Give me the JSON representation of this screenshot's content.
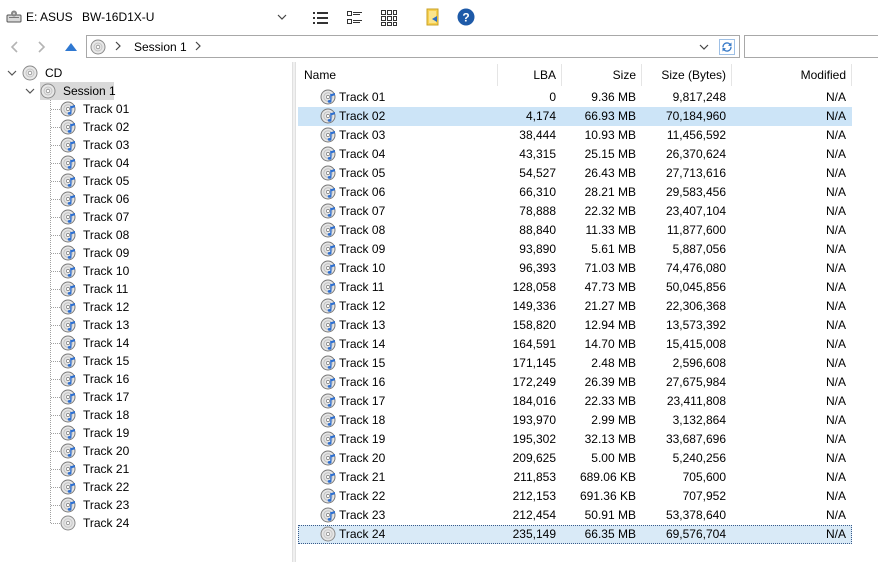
{
  "toolbar": {
    "drive_label": "E: ASUS",
    "device_label": "BW-16D1X-U",
    "icons": {
      "drive": "optical-drive-icon",
      "details": "details-view-icon",
      "tiles": "tiles-view-icon",
      "large": "large-icons-view-icon",
      "folder": "folder-arrow-icon",
      "help": "help-icon"
    },
    "help_color": "#1e5aa8",
    "folder_color": "#f7d04f"
  },
  "address": {
    "crumbs": [
      "Session 1"
    ],
    "icons": {
      "back": "back-arrow-icon",
      "forward": "forward-arrow-icon",
      "up": "up-arrow-icon",
      "refresh": "refresh-icon"
    }
  },
  "tree": {
    "root": "CD",
    "session": "Session 1",
    "tracks": [
      "Track 01",
      "Track 02",
      "Track 03",
      "Track 04",
      "Track 05",
      "Track 06",
      "Track 07",
      "Track 08",
      "Track 09",
      "Track 10",
      "Track 11",
      "Track 12",
      "Track 13",
      "Track 14",
      "Track 15",
      "Track 16",
      "Track 17",
      "Track 18",
      "Track 19",
      "Track 20",
      "Track 21",
      "Track 22",
      "Track 23",
      "Track 24"
    ],
    "audio_track_count": 23
  },
  "list": {
    "columns": [
      "Name",
      "LBA",
      "Size",
      "Size (Bytes)",
      "Modified"
    ],
    "rows": [
      {
        "name": "Track 01",
        "lba": "0",
        "size": "9.36 MB",
        "bytes": "9,817,248",
        "modified": "N/A"
      },
      {
        "name": "Track 02",
        "lba": "4,174",
        "size": "66.93 MB",
        "bytes": "70,184,960",
        "modified": "N/A"
      },
      {
        "name": "Track 03",
        "lba": "38,444",
        "size": "10.93 MB",
        "bytes": "11,456,592",
        "modified": "N/A"
      },
      {
        "name": "Track 04",
        "lba": "43,315",
        "size": "25.15 MB",
        "bytes": "26,370,624",
        "modified": "N/A"
      },
      {
        "name": "Track 05",
        "lba": "54,527",
        "size": "26.43 MB",
        "bytes": "27,713,616",
        "modified": "N/A"
      },
      {
        "name": "Track 06",
        "lba": "66,310",
        "size": "28.21 MB",
        "bytes": "29,583,456",
        "modified": "N/A"
      },
      {
        "name": "Track 07",
        "lba": "78,888",
        "size": "22.32 MB",
        "bytes": "23,407,104",
        "modified": "N/A"
      },
      {
        "name": "Track 08",
        "lba": "88,840",
        "size": "11.33 MB",
        "bytes": "11,877,600",
        "modified": "N/A"
      },
      {
        "name": "Track 09",
        "lba": "93,890",
        "size": "5.61 MB",
        "bytes": "5,887,056",
        "modified": "N/A"
      },
      {
        "name": "Track 10",
        "lba": "96,393",
        "size": "71.03 MB",
        "bytes": "74,476,080",
        "modified": "N/A"
      },
      {
        "name": "Track 11",
        "lba": "128,058",
        "size": "47.73 MB",
        "bytes": "50,045,856",
        "modified": "N/A"
      },
      {
        "name": "Track 12",
        "lba": "149,336",
        "size": "21.27 MB",
        "bytes": "22,306,368",
        "modified": "N/A"
      },
      {
        "name": "Track 13",
        "lba": "158,820",
        "size": "12.94 MB",
        "bytes": "13,573,392",
        "modified": "N/A"
      },
      {
        "name": "Track 14",
        "lba": "164,591",
        "size": "14.70 MB",
        "bytes": "15,415,008",
        "modified": "N/A"
      },
      {
        "name": "Track 15",
        "lba": "171,145",
        "size": "2.48 MB",
        "bytes": "2,596,608",
        "modified": "N/A"
      },
      {
        "name": "Track 16",
        "lba": "172,249",
        "size": "26.39 MB",
        "bytes": "27,675,984",
        "modified": "N/A"
      },
      {
        "name": "Track 17",
        "lba": "184,016",
        "size": "22.33 MB",
        "bytes": "23,411,808",
        "modified": "N/A"
      },
      {
        "name": "Track 18",
        "lba": "193,970",
        "size": "2.99 MB",
        "bytes": "3,132,864",
        "modified": "N/A"
      },
      {
        "name": "Track 19",
        "lba": "195,302",
        "size": "32.13 MB",
        "bytes": "33,687,696",
        "modified": "N/A"
      },
      {
        "name": "Track 20",
        "lba": "209,625",
        "size": "5.00 MB",
        "bytes": "5,240,256",
        "modified": "N/A"
      },
      {
        "name": "Track 21",
        "lba": "211,853",
        "size": "689.06 KB",
        "bytes": "705,600",
        "modified": "N/A"
      },
      {
        "name": "Track 22",
        "lba": "212,153",
        "size": "691.36 KB",
        "bytes": "707,952",
        "modified": "N/A"
      },
      {
        "name": "Track 23",
        "lba": "212,454",
        "size": "50.91 MB",
        "bytes": "53,378,640",
        "modified": "N/A"
      },
      {
        "name": "Track 24",
        "lba": "235,149",
        "size": "66.35 MB",
        "bytes": "69,576,704",
        "modified": "N/A"
      }
    ],
    "selected_index": 1,
    "focused_index": 23,
    "selection_color": "#cce4f7"
  }
}
